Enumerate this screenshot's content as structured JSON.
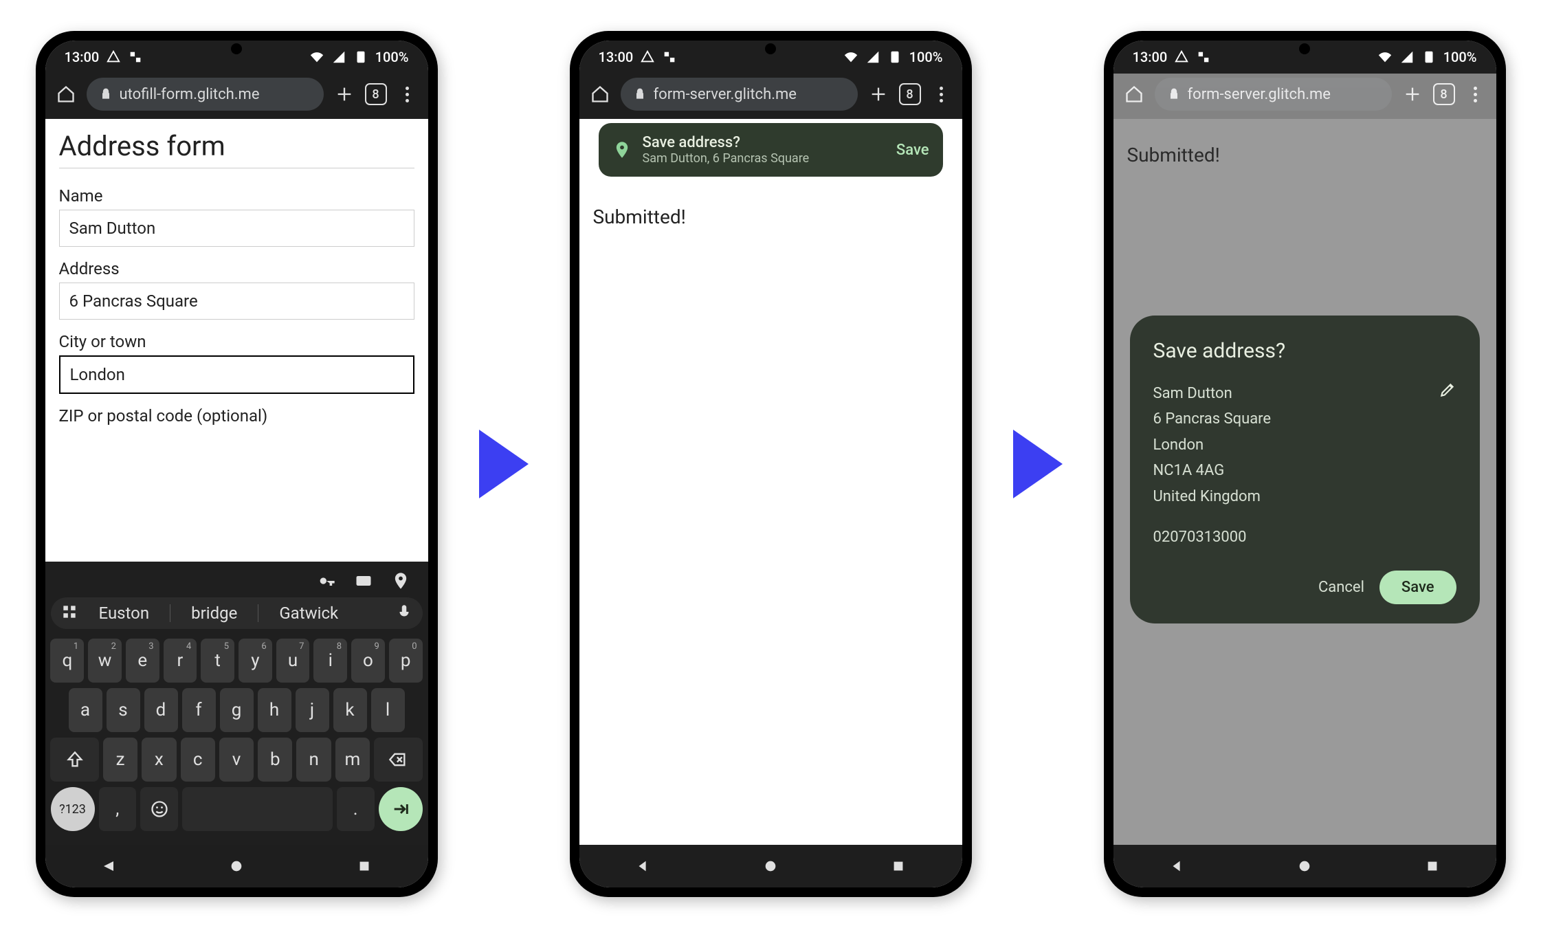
{
  "status": {
    "time": "13:00",
    "battery": "100%"
  },
  "tabs_count": "8",
  "phone1": {
    "url": "utofill-form.glitch.me",
    "form": {
      "title": "Address form",
      "name_label": "Name",
      "name_value": "Sam Dutton",
      "address_label": "Address",
      "address_value": "6 Pancras Square",
      "city_label": "City or town",
      "city_value": "London",
      "zip_label": "ZIP or postal code (optional)"
    },
    "keyboard": {
      "suggestions": [
        "Euston",
        "bridge",
        "Gatwick"
      ],
      "row1": [
        {
          "k": "q",
          "s": "1"
        },
        {
          "k": "w",
          "s": "2"
        },
        {
          "k": "e",
          "s": "3"
        },
        {
          "k": "r",
          "s": "4"
        },
        {
          "k": "t",
          "s": "5"
        },
        {
          "k": "y",
          "s": "6"
        },
        {
          "k": "u",
          "s": "7"
        },
        {
          "k": "i",
          "s": "8"
        },
        {
          "k": "o",
          "s": "9"
        },
        {
          "k": "p",
          "s": "0"
        }
      ],
      "row2": [
        "a",
        "s",
        "d",
        "f",
        "g",
        "h",
        "j",
        "k",
        "l"
      ],
      "row3": [
        "z",
        "x",
        "c",
        "v",
        "b",
        "n",
        "m"
      ],
      "sym": "?123"
    }
  },
  "phone2": {
    "url": "form-server.glitch.me",
    "page_text": "Submitted!",
    "banner": {
      "title": "Save address?",
      "subtitle": "Sam Dutton, 6 Pancras Square",
      "action": "Save"
    }
  },
  "phone3": {
    "url": "form-server.glitch.me",
    "page_text": "Submitted!",
    "dialog": {
      "title": "Save address?",
      "name": "Sam Dutton",
      "line1": "6 Pancras Square",
      "city": "London",
      "postcode": "NC1A 4AG",
      "country": "United Kingdom",
      "phone": "02070313000",
      "cancel": "Cancel",
      "save": "Save"
    }
  }
}
